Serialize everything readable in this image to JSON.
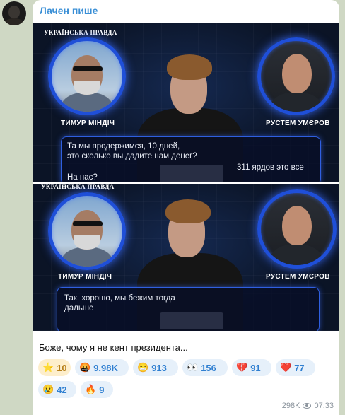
{
  "post": {
    "author": "Лачен пише",
    "caption": "Боже, чому я не кент президента...",
    "views": "298K",
    "time": "07:33"
  },
  "frames": [
    {
      "brand": "УКРАЇНСЬКА ПРАВДА",
      "left_name": "ТИМУР МІНДІЧ",
      "right_name": "РУСТЕМ УМЄРОВ",
      "subtitles": [
        "Та мы продержимся, 10 дней,",
        "это сколько вы дадите нам денег?",
        "311 ярдов это все",
        "На нас?"
      ]
    },
    {
      "brand": "УКРАЇНСЬКА ПРАВДА",
      "left_name": "ТИМУР МІНДІЧ",
      "right_name": "РУСТЕМ УМЄРОВ",
      "subtitles": [
        "Так, хорошо, мы бежим тогда",
        "дальше"
      ]
    }
  ],
  "reactions": [
    {
      "icon": "star-icon",
      "emoji": "⭐",
      "count": "10"
    },
    {
      "icon": "angry-face-icon",
      "emoji": "🤬",
      "count": "9.98K"
    },
    {
      "icon": "grimacing-face-icon",
      "emoji": "😁",
      "count": "913"
    },
    {
      "icon": "eyes-icon",
      "emoji": "👀",
      "count": "156"
    },
    {
      "icon": "broken-heart-icon",
      "emoji": "💔",
      "count": "91"
    },
    {
      "icon": "heart-icon",
      "emoji": "❤️",
      "count": "77"
    },
    {
      "icon": "crying-face-icon",
      "emoji": "😢",
      "count": "42"
    },
    {
      "icon": "fire-icon",
      "emoji": "🔥",
      "count": "9"
    }
  ]
}
